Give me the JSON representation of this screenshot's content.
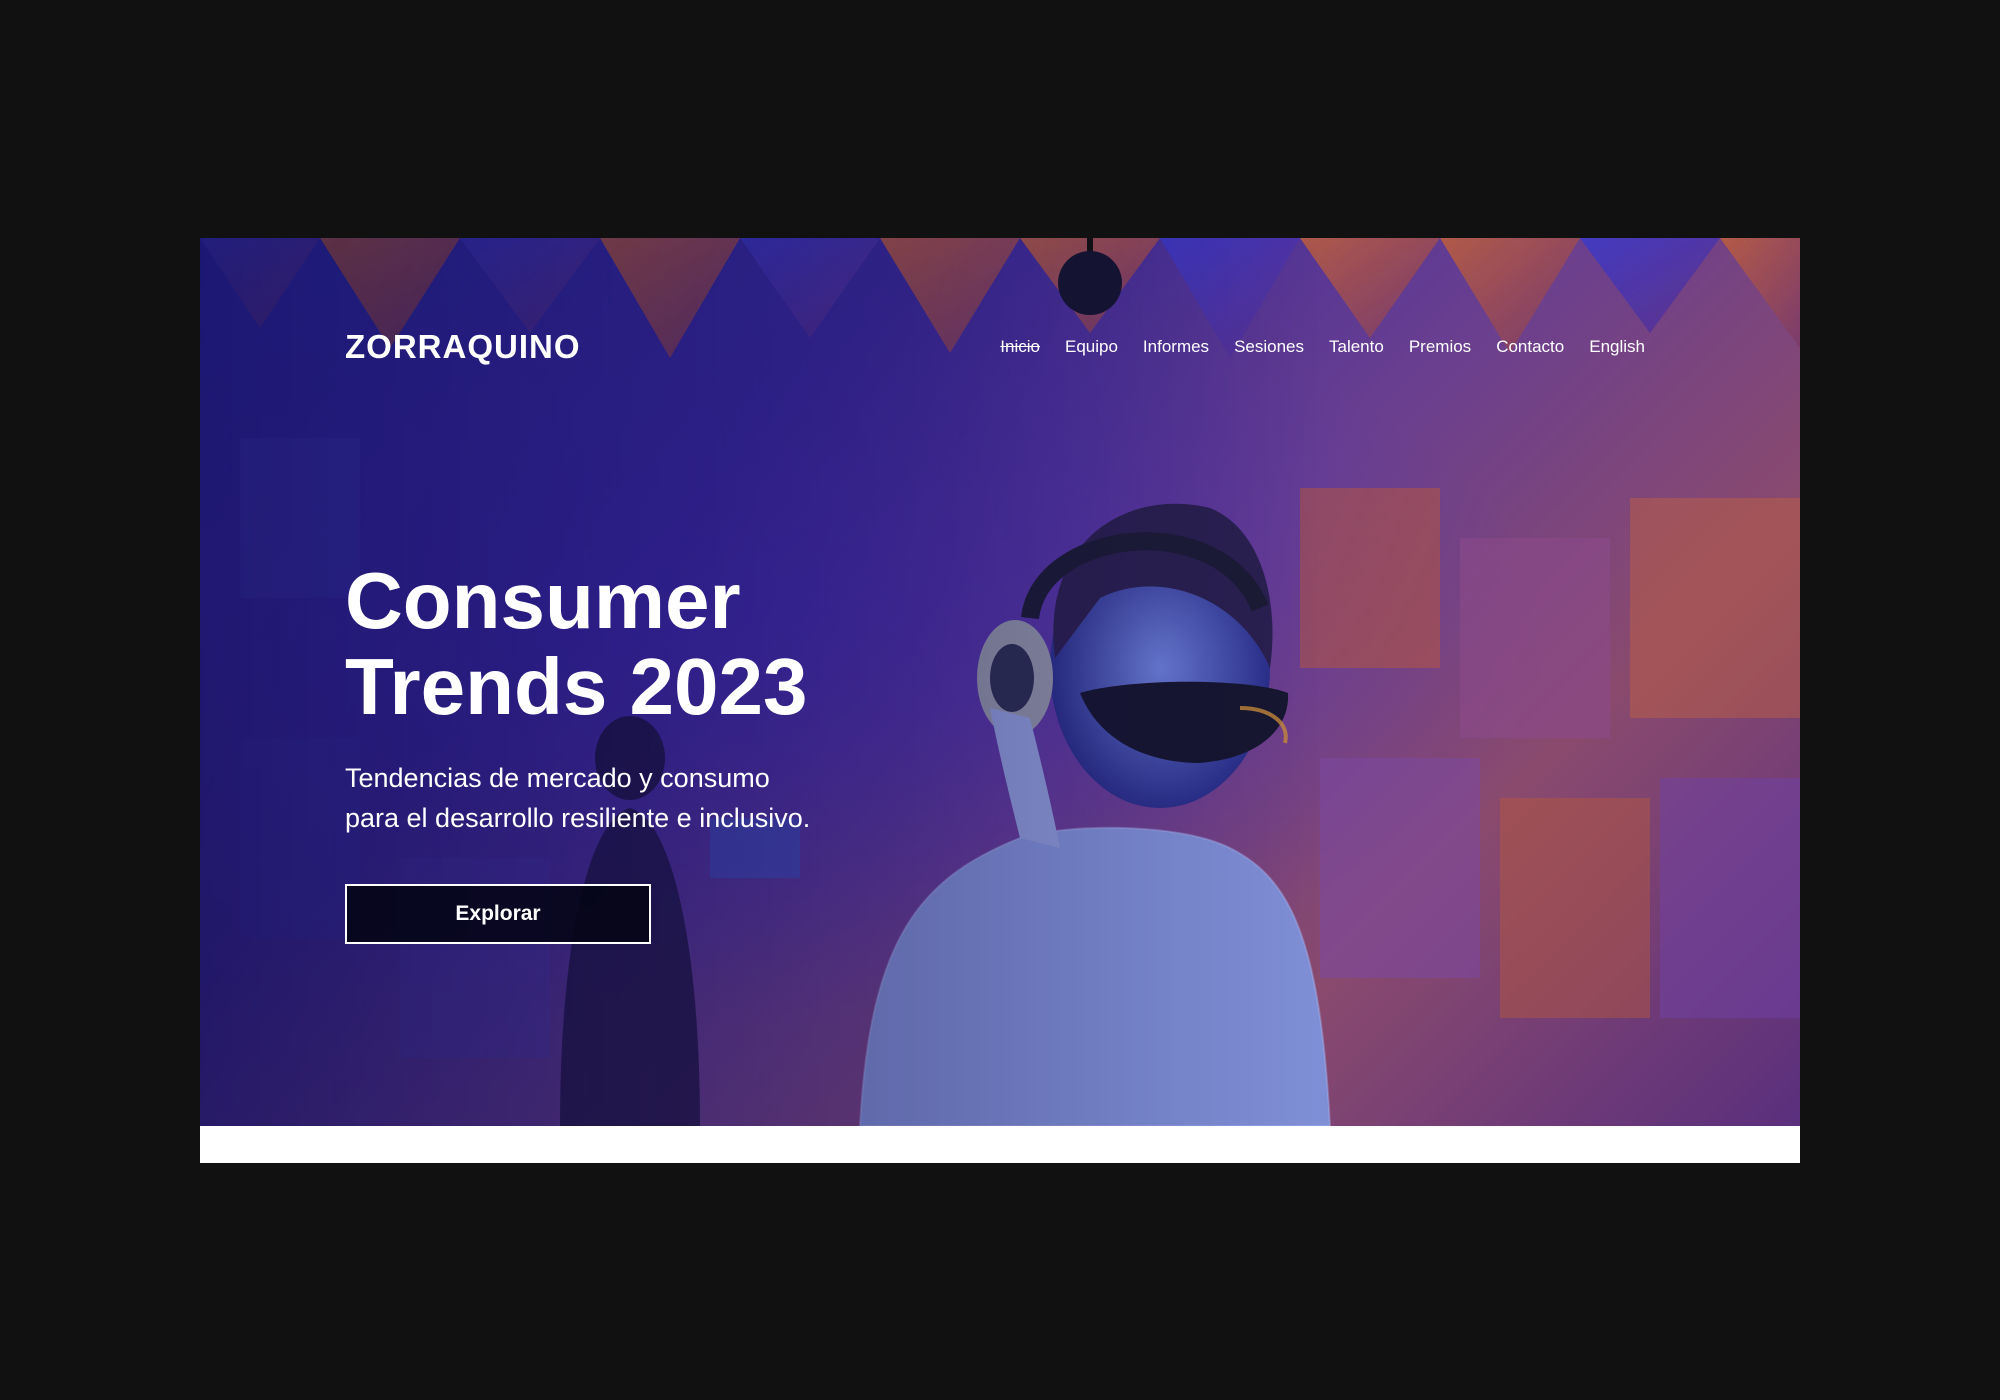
{
  "site": {
    "logo": "ZORRAQUINO"
  },
  "nav": {
    "items": [
      {
        "label": "Inicio",
        "strike": true
      },
      {
        "label": "Equipo"
      },
      {
        "label": "Informes"
      },
      {
        "label": "Sesiones"
      },
      {
        "label": "Talento"
      },
      {
        "label": "Premios"
      },
      {
        "label": "Contacto"
      },
      {
        "label": "English"
      }
    ]
  },
  "hero": {
    "title_line1": "Consumer",
    "title_line2": "Trends 2023",
    "subtitle_line1": "Tendencias de mercado y consumo",
    "subtitle_line2": "para el desarrollo resiliente e inclusivo.",
    "cta_label": "Explorar",
    "image_alt": "woman-with-headphones-and-face-mask-in-anechoic-chamber"
  },
  "colors": {
    "page_bg": "#111111",
    "hero_blue": "#2b2bb8",
    "hero_orange": "#b5573a",
    "text": "#ffffff",
    "button_bg": "#05051a"
  }
}
